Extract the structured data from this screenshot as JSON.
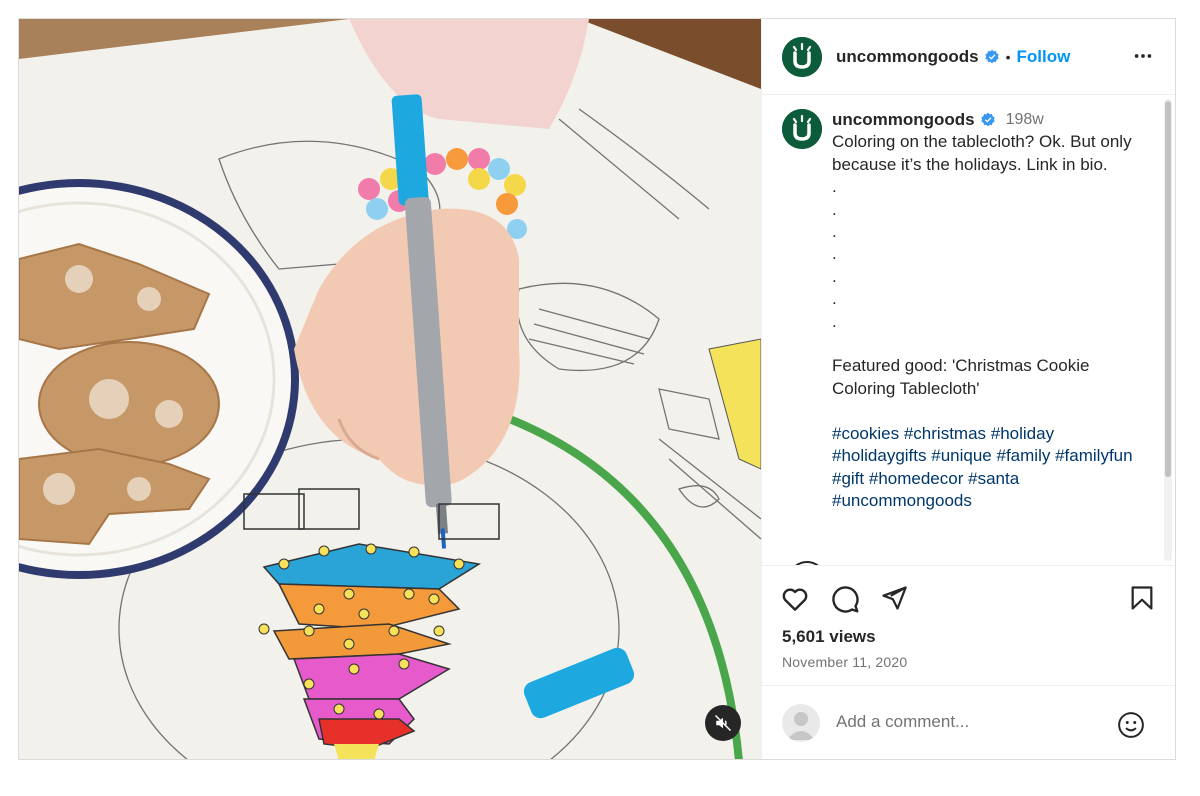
{
  "post": {
    "username": "uncommongoods",
    "follow_label": "Follow",
    "separator": "•",
    "time_ago": "198w",
    "caption": "Coloring on the tablecloth? Ok. But only because it’s the holidays. Link in bio.\n.\n.\n.\n.\n.\n.\n.\n\nFeatured good: 'Christmas Cookie Coloring Tablecloth'\n\n",
    "hashtags": [
      "#cookies",
      "#christmas",
      "#holiday",
      "#holidaygifts",
      "#unique",
      "#family",
      "#familyfun",
      "#gift",
      "#homedecor",
      "#santa",
      "#uncommongoods"
    ],
    "views": "5,601 views",
    "date": "November 11, 2020",
    "comment_placeholder": "Add a comment..."
  },
  "icons": {
    "verified": "verified-badge-icon",
    "more": "more-options-icon",
    "like": "heart-icon",
    "comment": "comment-bubble-icon",
    "share": "paper-plane-icon",
    "save": "bookmark-icon",
    "emoji": "emoji-icon",
    "mute": "speaker-muted-icon",
    "logo": "uncommongoods-logo"
  },
  "colors": {
    "brand_green": "#0c5c3c",
    "link_blue": "#0095f6",
    "hashtag_blue": "#00376b",
    "verified_blue": "#3897f0"
  }
}
